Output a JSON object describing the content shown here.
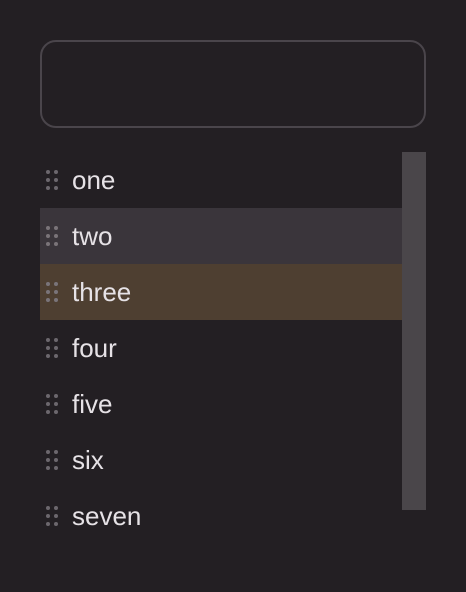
{
  "drop_zone": {
    "value": ""
  },
  "list": {
    "items": [
      {
        "label": "one",
        "state": "normal"
      },
      {
        "label": "two",
        "state": "hover"
      },
      {
        "label": "three",
        "state": "selected"
      },
      {
        "label": "four",
        "state": "normal"
      },
      {
        "label": "five",
        "state": "normal"
      },
      {
        "label": "six",
        "state": "normal"
      },
      {
        "label": "seven",
        "state": "normal"
      }
    ]
  },
  "icons": {
    "drag_handle": "drag-handle-icon"
  },
  "colors": {
    "background": "#231f23",
    "hover_row": "#3a353b",
    "selected_row": "#4e3f31",
    "scrollbar": "#4a464a",
    "text": "#e6e2e6"
  }
}
